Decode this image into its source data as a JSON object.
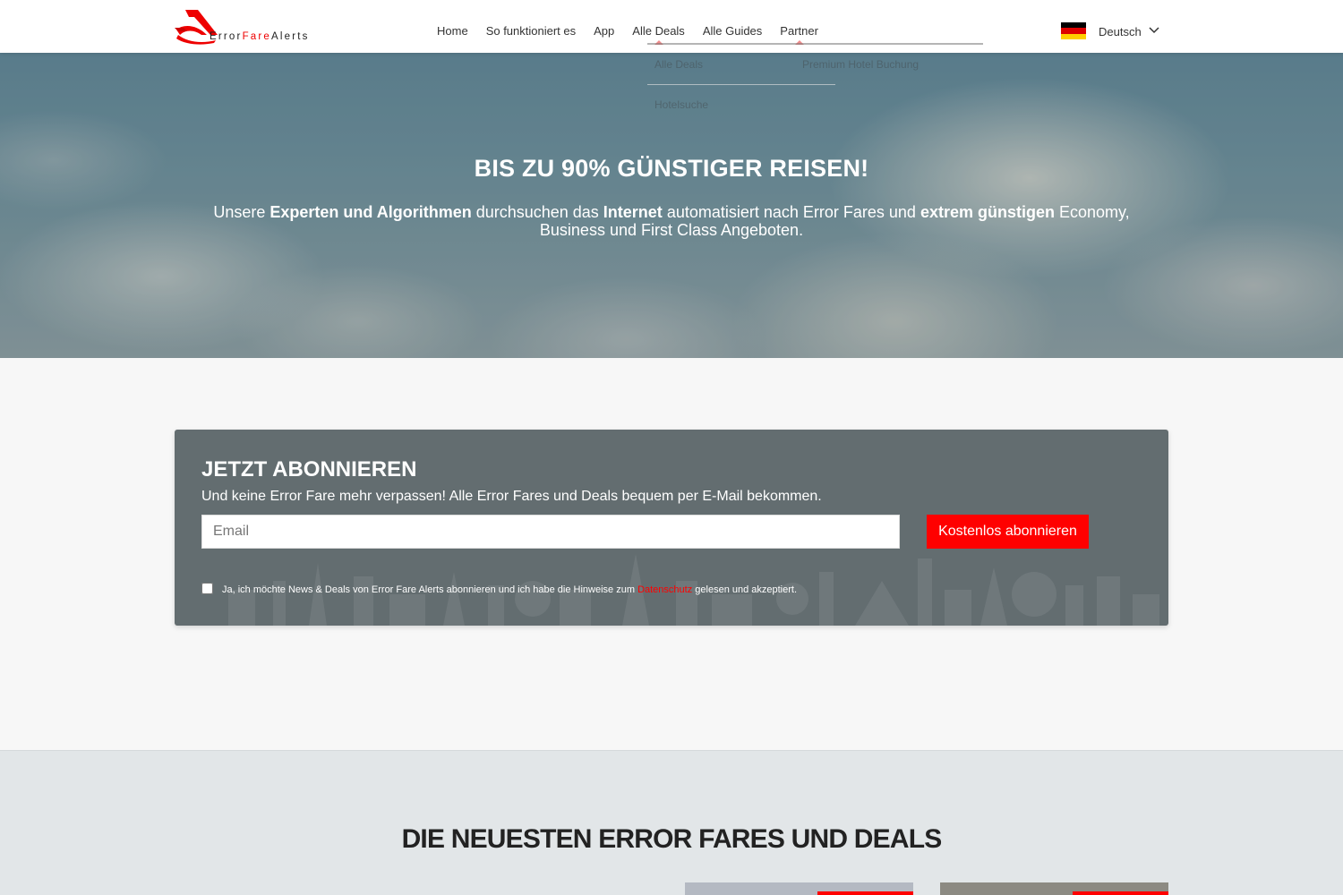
{
  "brand": {
    "name_part1": "Error",
    "name_part2": "Fare",
    "name_part3": "Alerts",
    "accent_color": "#ff0000"
  },
  "nav": {
    "items": [
      {
        "label": "Home"
      },
      {
        "label": "So funktioniert es"
      },
      {
        "label": "App"
      },
      {
        "label": "Alle Deals"
      },
      {
        "label": "Alle Guides"
      },
      {
        "label": "Partner"
      }
    ]
  },
  "dropdown": {
    "items": [
      {
        "label": "Alle Deals"
      },
      {
        "label": "Premium Hotel Buchung"
      },
      {
        "label": "Hotelsuche"
      }
    ]
  },
  "language": {
    "label": "Deutsch",
    "flag_icon": "germany-flag-icon"
  },
  "hero": {
    "title": "BIS ZU 90% GÜNSTIGER REISEN!",
    "text_1": "Unsere ",
    "text_2_bold": "Experten und Algorithmen",
    "text_3": " durchsuchen das ",
    "text_4_bold": "Internet",
    "text_5": " automatisiert nach Error Fares und ",
    "text_6_bold": "extrem günstigen",
    "text_7": " Economy, Business und First Class Angeboten."
  },
  "subscribe": {
    "title": "JETZT ABONNIEREN",
    "text": "Und keine Error Fare mehr verpassen! Alle Error Fares und Deals bequem per E-Mail bekommen.",
    "email_placeholder": "Email",
    "email_value": "",
    "button_label": "Kostenlos abonnieren",
    "consent_text_1": "Ja, ich möchte News & Deals von Error Fare Alerts abonnieren und ich habe die Hinweise zum ",
    "consent_link": "Datenschutz",
    "consent_text_2": " gelesen und akzeptiert.",
    "consent_checked": false
  },
  "deals": {
    "title": "DIE NEUESTEN ERROR FARES UND DEALS"
  }
}
